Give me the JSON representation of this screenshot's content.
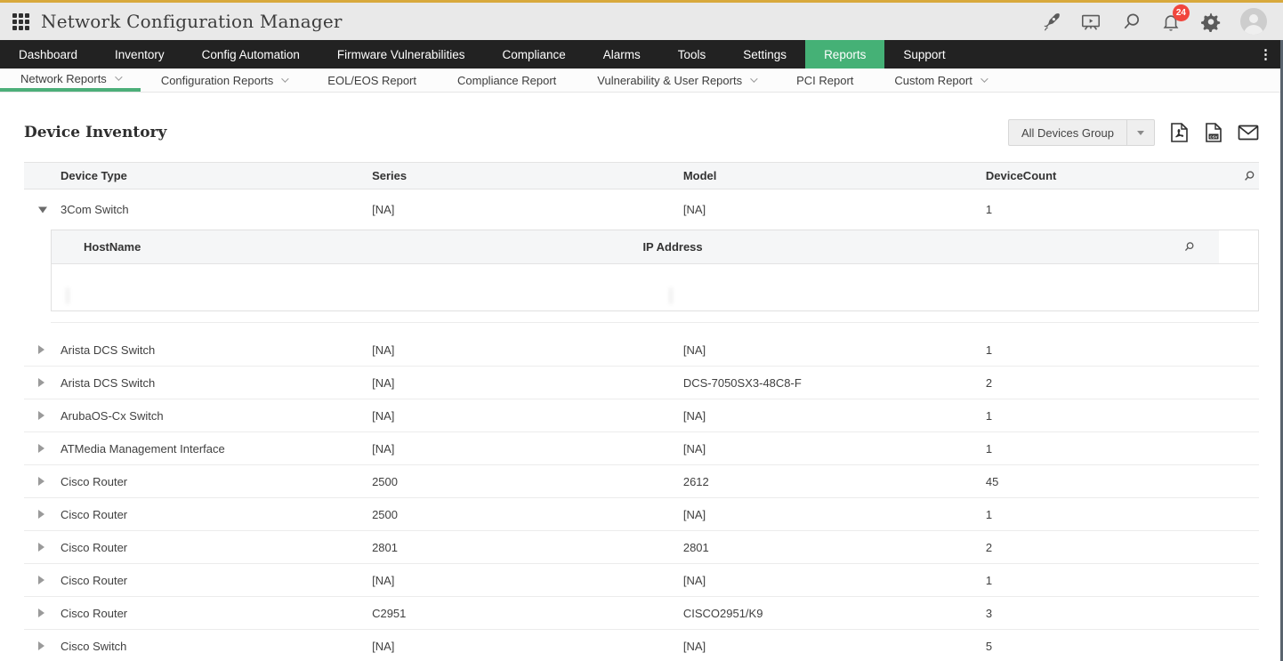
{
  "colors": {
    "accent_green": "#45b176",
    "topbar_gold": "#d8a93c",
    "nav_bg": "#222222",
    "badge_red": "#f1463d"
  },
  "topbar": {
    "title": "Network Configuration Manager",
    "notification_count": "24",
    "icons": [
      "rocket-icon",
      "presentation-icon",
      "search-icon",
      "bell-icon",
      "gear-icon",
      "avatar"
    ]
  },
  "nav": {
    "items": [
      {
        "label": "Dashboard",
        "active": false
      },
      {
        "label": "Inventory",
        "active": false
      },
      {
        "label": "Config Automation",
        "active": false
      },
      {
        "label": "Firmware Vulnerabilities",
        "active": false
      },
      {
        "label": "Compliance",
        "active": false
      },
      {
        "label": "Alarms",
        "active": false
      },
      {
        "label": "Tools",
        "active": false
      },
      {
        "label": "Settings",
        "active": false
      },
      {
        "label": "Reports",
        "active": true
      },
      {
        "label": "Support",
        "active": false
      }
    ]
  },
  "subnav": {
    "items": [
      {
        "label": "Network Reports",
        "caret": true,
        "active": true
      },
      {
        "label": "Configuration Reports",
        "caret": true,
        "active": false
      },
      {
        "label": "EOL/EOS Report",
        "caret": false,
        "active": false
      },
      {
        "label": "Compliance Report",
        "caret": false,
        "active": false
      },
      {
        "label": "Vulnerability & User Reports",
        "caret": true,
        "active": false
      },
      {
        "label": "PCI Report",
        "caret": false,
        "active": false
      },
      {
        "label": "Custom Report",
        "caret": true,
        "active": false
      }
    ]
  },
  "page": {
    "title": "Device Inventory",
    "group_filter_value": "All Devices Group",
    "export_icons": [
      "pdf-export-icon",
      "csv-export-icon",
      "email-export-icon"
    ]
  },
  "table": {
    "columns": [
      "Device Type",
      "Series",
      "Model",
      "DeviceCount"
    ],
    "rows": [
      {
        "device_type": "3Com Switch",
        "series": "[NA]",
        "model": "[NA]",
        "device_count": "1",
        "expanded": true
      },
      {
        "device_type": "Arista DCS Switch",
        "series": "[NA]",
        "model": "[NA]",
        "device_count": "1",
        "expanded": false
      },
      {
        "device_type": "Arista DCS Switch",
        "series": "[NA]",
        "model": "DCS-7050SX3-48C8-F",
        "device_count": "2",
        "expanded": false
      },
      {
        "device_type": "ArubaOS-Cx Switch",
        "series": "[NA]",
        "model": "[NA]",
        "device_count": "1",
        "expanded": false
      },
      {
        "device_type": "ATMedia Management Interface",
        "series": "[NA]",
        "model": "[NA]",
        "device_count": "1",
        "expanded": false
      },
      {
        "device_type": "Cisco Router",
        "series": "2500",
        "model": "2612",
        "device_count": "45",
        "expanded": false
      },
      {
        "device_type": "Cisco Router",
        "series": "2500",
        "model": "[NA]",
        "device_count": "1",
        "expanded": false
      },
      {
        "device_type": "Cisco Router",
        "series": "2801",
        "model": "2801",
        "device_count": "2",
        "expanded": false
      },
      {
        "device_type": "Cisco Router",
        "series": "[NA]",
        "model": "[NA]",
        "device_count": "1",
        "expanded": false
      },
      {
        "device_type": "Cisco Router",
        "series": "C2951",
        "model": "CISCO2951/K9",
        "device_count": "3",
        "expanded": false
      },
      {
        "device_type": "Cisco Switch",
        "series": "[NA]",
        "model": "[NA]",
        "device_count": "5",
        "expanded": false
      }
    ],
    "nested": {
      "columns": [
        "HostName",
        "IP Address"
      ],
      "rows": [
        {
          "hostname_redacted": true,
          "ip_redacted": true
        }
      ]
    }
  }
}
